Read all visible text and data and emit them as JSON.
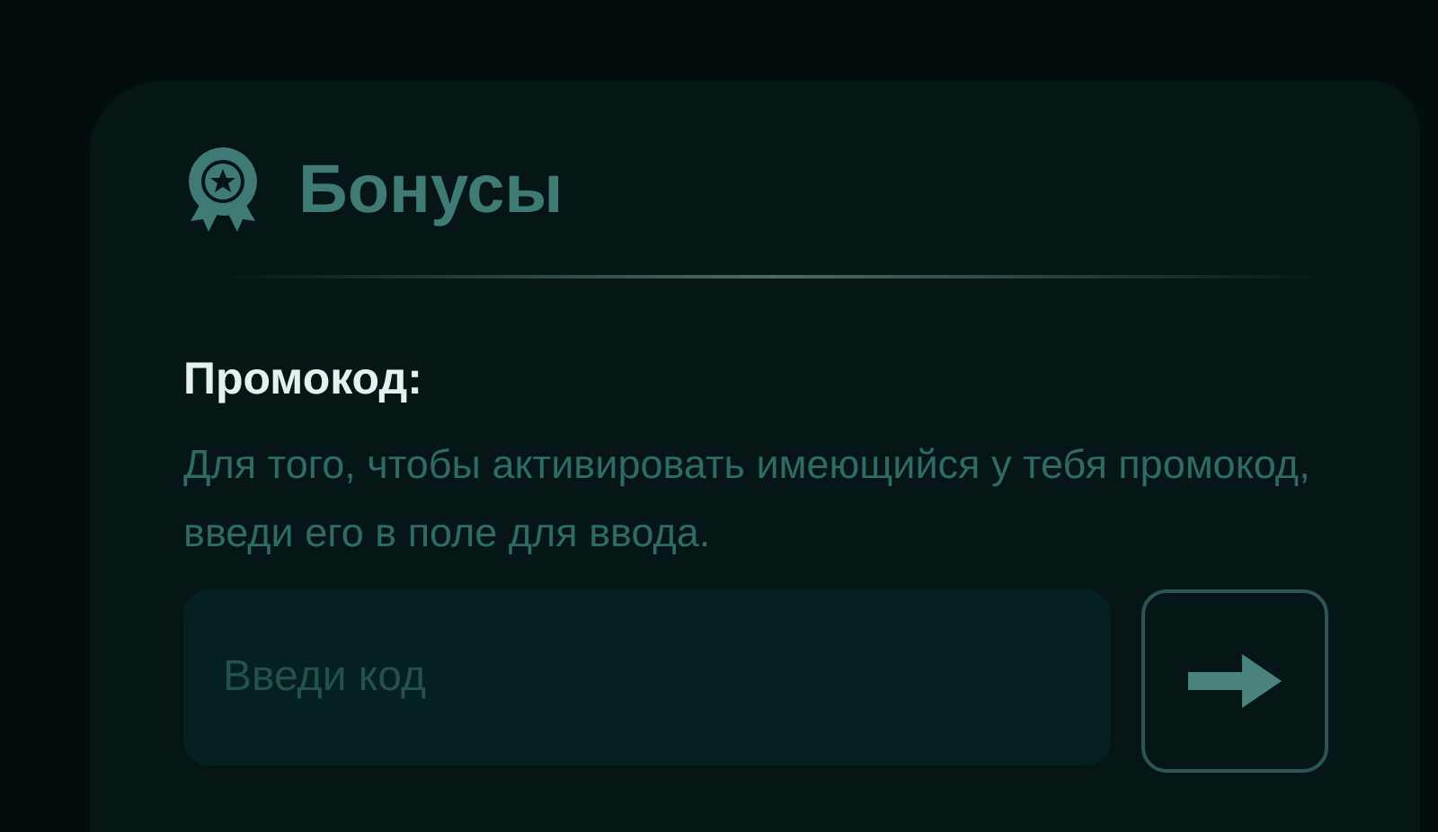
{
  "card": {
    "title": "Бонусы"
  },
  "promo": {
    "label": "Промокод:",
    "description": "Для того, чтобы активировать имеющийся у тебя промокод, введи его в поле для ввода.",
    "placeholder": "Введи код"
  }
}
